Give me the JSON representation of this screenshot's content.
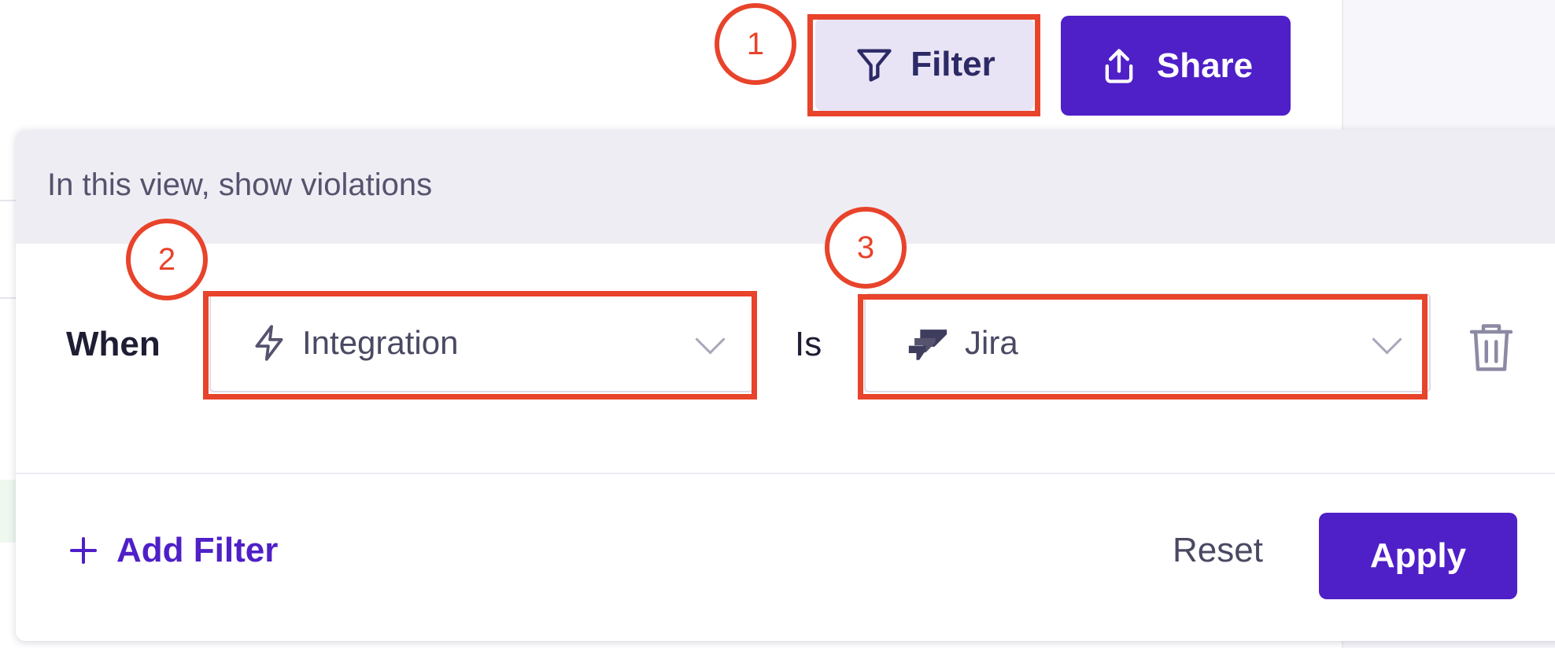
{
  "toolbar": {
    "filter_label": "Filter",
    "share_label": "Share"
  },
  "filter_panel": {
    "header": "In this view, show violations",
    "rule": {
      "when_label": "When",
      "field": {
        "value": "Integration",
        "icon": "lightning-icon"
      },
      "operator_label": "Is",
      "value": {
        "value": "Jira",
        "icon": "jira-logo-icon"
      }
    },
    "add_filter_label": "Add Filter",
    "reset_label": "Reset",
    "apply_label": "Apply"
  },
  "annotations": {
    "step1": "1",
    "step2": "2",
    "step3": "3"
  },
  "colors": {
    "accent": "#4f1fc7",
    "annotation": "#e8432b",
    "filter_button_bg": "#e9e4f5"
  }
}
